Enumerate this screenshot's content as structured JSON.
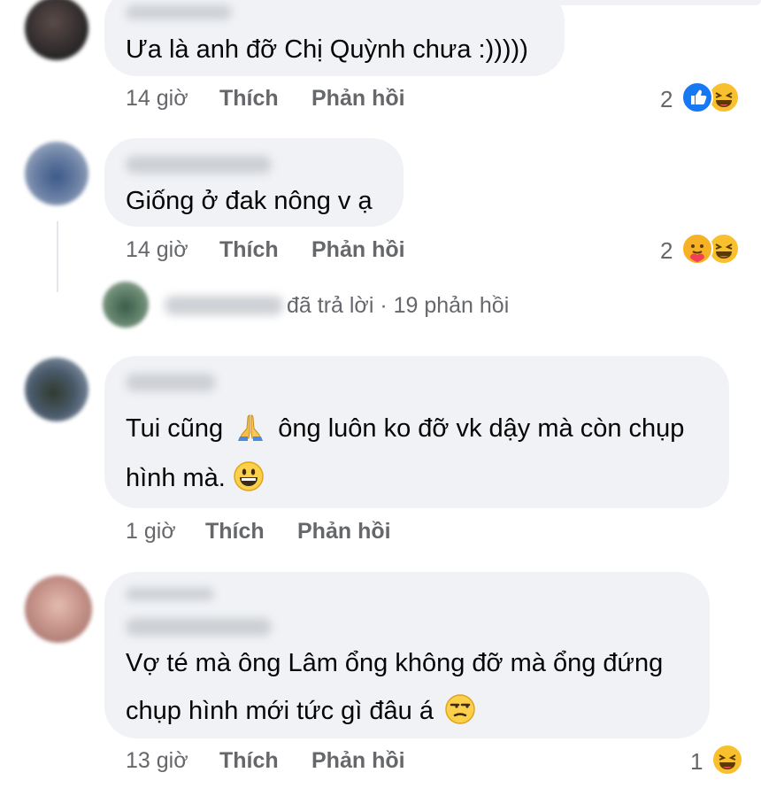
{
  "comments": [
    {
      "text": "Ưa là anh đỡ Chị Quỳnh chưa :)))))",
      "time": "14 giờ",
      "like": "Thích",
      "reply": "Phản hồi",
      "reaction_count": "2",
      "reactions": [
        "like",
        "haha"
      ]
    },
    {
      "text": "Giống ở đak nông v ạ",
      "time": "14 giờ",
      "like": "Thích",
      "reply": "Phản hồi",
      "reaction_count": "2",
      "reactions": [
        "care",
        "haha"
      ],
      "replies_summary": "đã trả lời · 19 phản hồi"
    },
    {
      "text_part1": "Tui cũng",
      "text_part2": "ông luôn ko đỡ vk dậy mà còn chụp",
      "text_line2": "hình mà.",
      "time": "1 giờ",
      "like": "Thích",
      "reply": "Phản hồi"
    },
    {
      "text_line1": "Vợ té mà ông Lâm ổng không đỡ mà ổng đứng",
      "text_line2": "chụp hình mới tức gì đâu á",
      "time": "13 giờ",
      "like": "Thích",
      "reply": "Phản hồi",
      "reaction_count": "1",
      "reactions": [
        "haha"
      ]
    }
  ],
  "colors": {
    "bubble": "#f0f2f5",
    "meta": "#65676b",
    "like_blue": "#1877f2",
    "haha_yellow": "#f7c02c"
  }
}
